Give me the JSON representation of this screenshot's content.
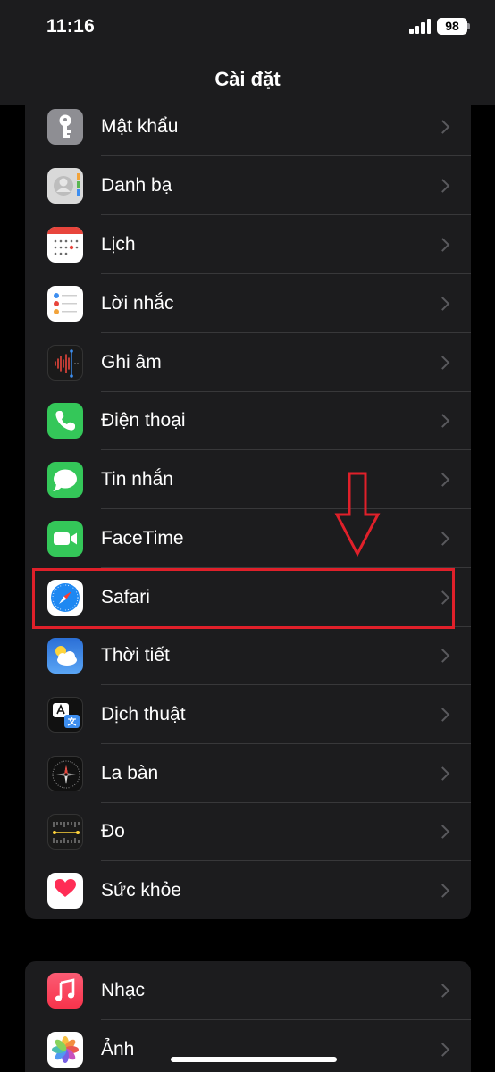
{
  "status_bar": {
    "time": "11:16",
    "battery": "98"
  },
  "nav": {
    "title": "Cài đặt"
  },
  "group1": [
    {
      "label": "Mật khẩu"
    },
    {
      "label": "Danh bạ"
    },
    {
      "label": "Lịch"
    },
    {
      "label": "Lời nhắc"
    },
    {
      "label": "Ghi âm"
    },
    {
      "label": "Điện thoại"
    },
    {
      "label": "Tin nhắn"
    },
    {
      "label": "FaceTime"
    },
    {
      "label": "Safari"
    },
    {
      "label": "Thời tiết"
    },
    {
      "label": "Dịch thuật"
    },
    {
      "label": "La bàn"
    },
    {
      "label": "Đo"
    },
    {
      "label": "Sức khỏe"
    }
  ],
  "group2": [
    {
      "label": "Nhạc"
    },
    {
      "label": "Ảnh"
    }
  ],
  "colors": {
    "background": "#000000",
    "group_background": "#1c1c1e",
    "separator": "#38383a",
    "annotation": "#e0202a"
  }
}
